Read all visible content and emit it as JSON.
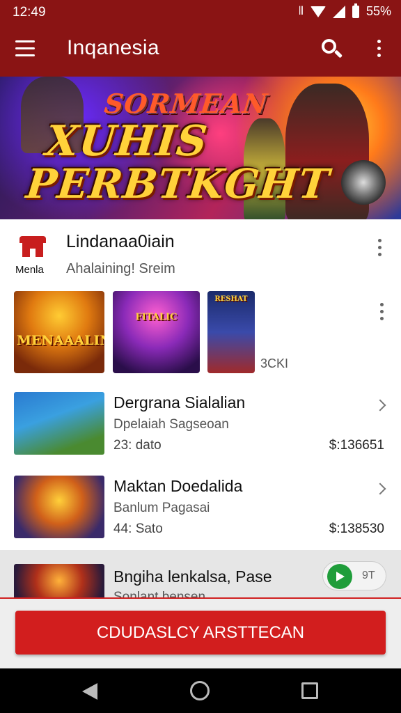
{
  "status_bar": {
    "time": "12:49",
    "battery": "55%"
  },
  "app_bar": {
    "title": "Inqanesia"
  },
  "hero": {
    "line1": "SORMEAN",
    "line2": "XUHIS",
    "line3": "PERBTKGHT"
  },
  "card": {
    "brand_label": "Menla",
    "heading": "Lindanaa0iain",
    "subheading": "Ahalaining! Sreim",
    "thumbnails": [
      {
        "caption": "MENAAALIN"
      },
      {
        "caption": "FITALIC"
      },
      {
        "caption": "RESHAT"
      }
    ],
    "more_count": "3CKI"
  },
  "items": [
    {
      "title": "Dergrana Sialalian",
      "subtitle": "Dpelaiah Sagseoan",
      "meta": "23: dato",
      "price": "$:136651"
    },
    {
      "title": "Maktan Doedalida",
      "subtitle": "Banlum Pagasai",
      "meta": "44: Sato",
      "price": "$:138530"
    },
    {
      "title": "Bngiha lenkalsa, Pase",
      "subtitle": "Sonlant bensen",
      "toggle_value": "9T"
    }
  ],
  "cta": {
    "label": "CDUDASLCY ARSTTECAN"
  },
  "colors": {
    "primary": "#8a1414",
    "accent": "#d21e1e",
    "play": "#1f9d3a"
  }
}
